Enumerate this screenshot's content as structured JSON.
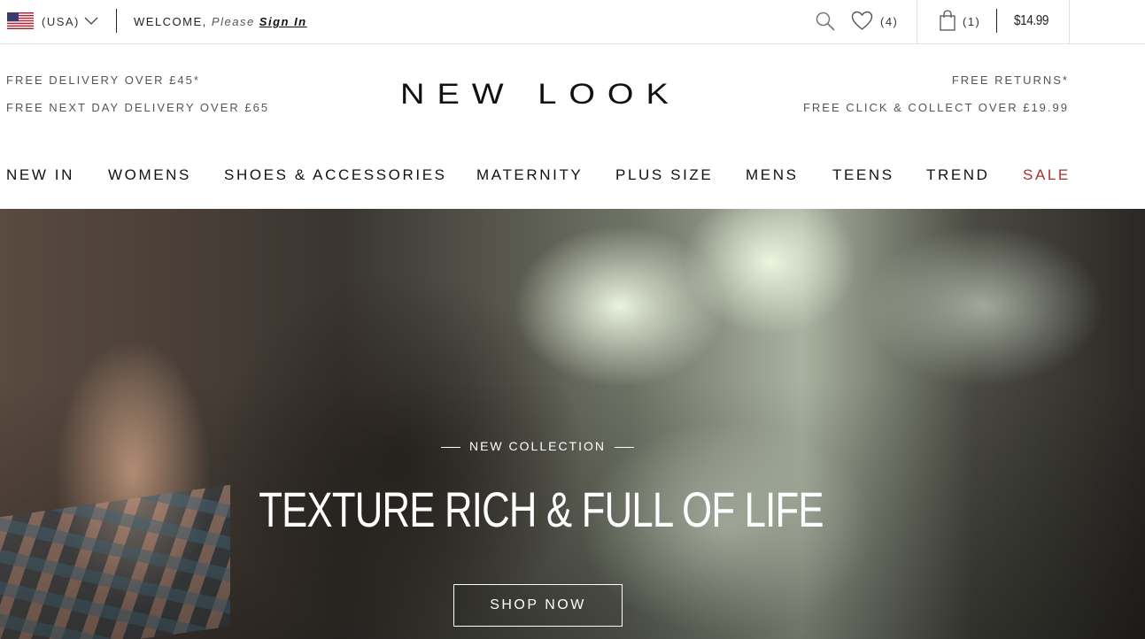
{
  "topbar": {
    "country": "(USA)",
    "welcome_prefix": "WELCOME,",
    "welcome_please": "Please",
    "sign_in": "Sign In",
    "wishlist_count": "(4)",
    "bag_count": "(1)",
    "bag_total": "$14.99"
  },
  "promos": {
    "left_1": "FREE DELIVERY OVER £45*",
    "left_2": "FREE NEXT DAY DELIVERY OVER £65",
    "right_1": "FREE RETURNS*",
    "right_2": "FREE CLICK & COLLECT OVER £19.99"
  },
  "brand": {
    "logo_text": "NEW LOOK"
  },
  "nav": {
    "items": [
      "NEW IN",
      "WOMENS",
      "SHOES & ACCESSORIES",
      "MATERNITY",
      "PLUS SIZE",
      "MENS",
      "TEENS",
      "TREND",
      "SALE"
    ]
  },
  "hero": {
    "kicker": "NEW COLLECTION",
    "headline": "TEXTURE RICH & FULL OF LIFE",
    "cta": "SHOP NOW"
  },
  "colors": {
    "sale": "#a8312f",
    "text": "#111111"
  },
  "icons": [
    "us-flag-icon",
    "chevron-down-icon",
    "search-icon",
    "heart-icon",
    "shopping-bag-icon"
  ]
}
